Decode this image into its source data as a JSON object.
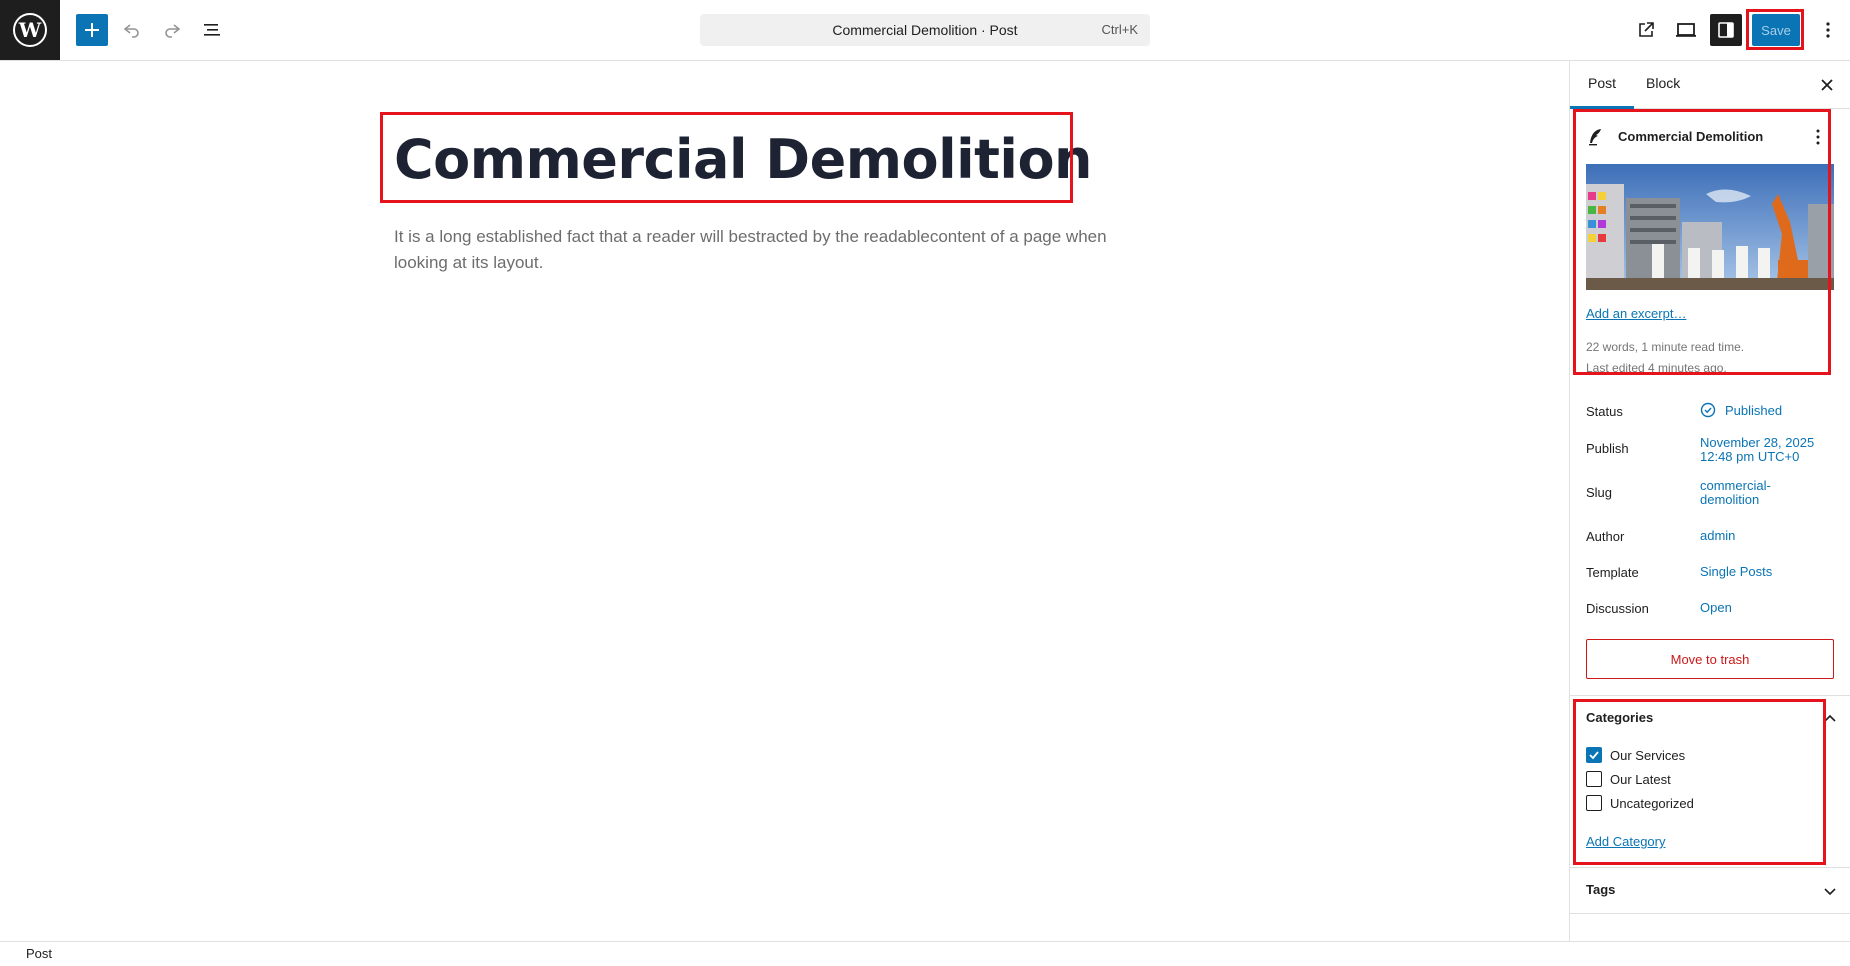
{
  "toolbar": {
    "command_title": "Commercial Demolition · Post",
    "command_shortcut": "Ctrl+K",
    "save_label": "Save"
  },
  "editor": {
    "title": "Commercial Demolition",
    "paragraph": "It is a long established fact that a reader will bestracted by the readablecontent of a page when looking at its layout."
  },
  "sidebar": {
    "tabs": [
      "Post",
      "Block"
    ],
    "post_card": {
      "title": "Commercial Demolition",
      "excerpt_link": "Add an excerpt…",
      "word_count": "22 words, 1 minute read time.",
      "last_edited": "Last edited 4 minutes ago."
    },
    "rows": {
      "status_label": "Status",
      "status_value": "Published",
      "publish_label": "Publish",
      "publish_date": "November 28, 2025",
      "publish_time": "12:48 pm UTC+0",
      "slug_label": "Slug",
      "slug_line1": "commercial-",
      "slug_line2": "demolition",
      "author_label": "Author",
      "author_value": "admin",
      "template_label": "Template",
      "template_value": "Single Posts",
      "discussion_label": "Discussion",
      "discussion_value": "Open"
    },
    "trash_label": "Move to trash",
    "categories": {
      "title": "Categories",
      "items": [
        {
          "label": "Our Services",
          "checked": true
        },
        {
          "label": "Our Latest",
          "checked": false
        },
        {
          "label": "Uncategorized",
          "checked": false
        }
      ],
      "add_label": "Add Category"
    },
    "tags_title": "Tags"
  },
  "footer": {
    "breadcrumb": "Post"
  },
  "colors": {
    "accent": "#0a74b5",
    "highlight": "#e5141c",
    "danger": "#cc1818"
  }
}
